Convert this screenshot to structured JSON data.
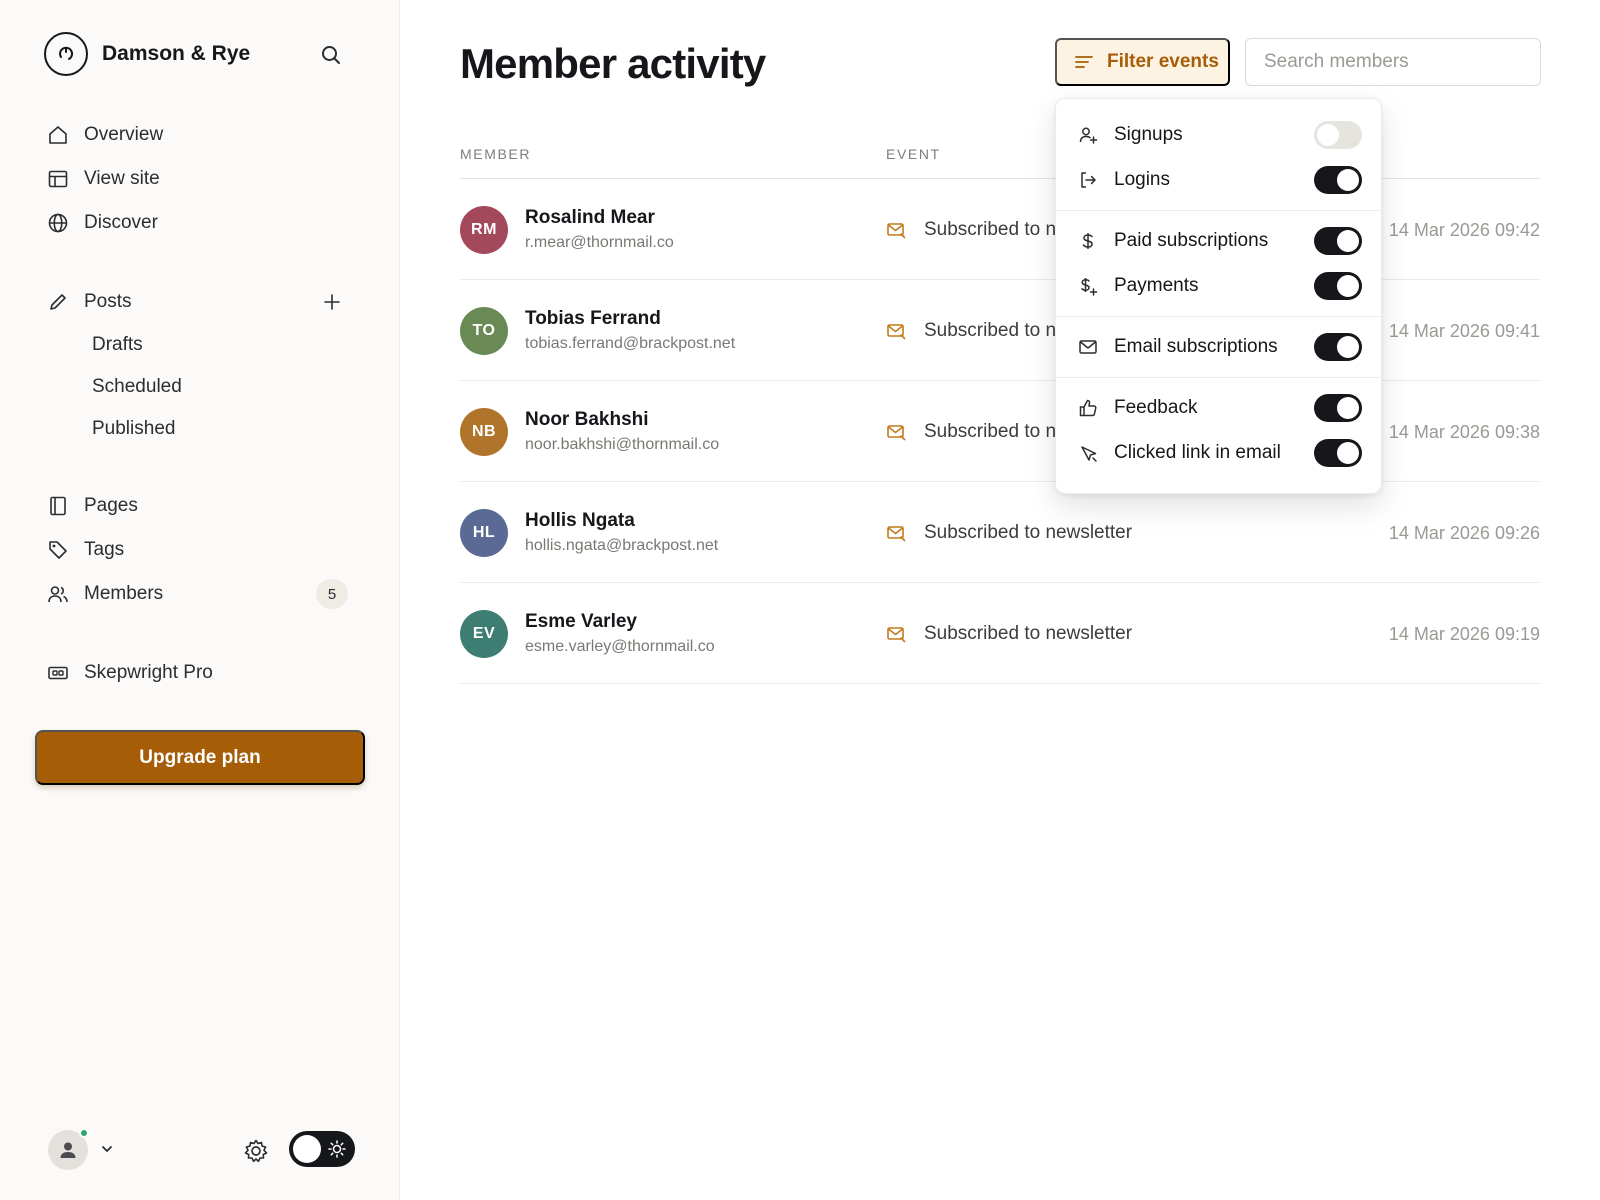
{
  "brand": {
    "name": "Damson & Rye"
  },
  "sidebar": {
    "primary": [
      {
        "label": "Overview",
        "icon": "home-icon"
      },
      {
        "label": "View site",
        "icon": "layout-icon"
      },
      {
        "label": "Discover",
        "icon": "globe-icon"
      }
    ],
    "posts": {
      "label": "Posts",
      "icon": "pencil-icon",
      "sub": [
        "Drafts",
        "Scheduled",
        "Published"
      ]
    },
    "secondary": [
      {
        "label": "Pages",
        "icon": "page-icon"
      },
      {
        "label": "Tags",
        "icon": "tag-icon"
      },
      {
        "label": "Members",
        "icon": "members-icon",
        "count": "5"
      }
    ],
    "pro": {
      "label": "Skepwright Pro",
      "icon": "ticket-icon"
    },
    "upgrade_label": "Upgrade plan"
  },
  "main": {
    "title": "Member activity",
    "filter_label": "Filter events",
    "search_placeholder": "Search members",
    "columns": {
      "member": "MEMBER",
      "event": "EVENT"
    },
    "rows": [
      {
        "initials": "RM",
        "color": "#a4495c",
        "name": "Rosalind Mear",
        "email": "r.mear@thornmail.co",
        "event": "Subscribed to n",
        "time": "14 Mar 2026 09:42"
      },
      {
        "initials": "TO",
        "color": "#6a8a55",
        "name": "Tobias Ferrand",
        "email": "tobias.ferrand@brackpost.net",
        "event": "Subscribed to n",
        "time": "14 Mar 2026 09:41"
      },
      {
        "initials": "NB",
        "color": "#b0752a",
        "name": "Noor Bakhshi",
        "email": "noor.bakhshi@thornmail.co",
        "event": "Subscribed to n",
        "time": "14 Mar 2026 09:38"
      },
      {
        "initials": "HL",
        "color": "#5a6a95",
        "name": "Hollis Ngata",
        "email": "hollis.ngata@brackpost.net",
        "event": "Subscribed to newsletter",
        "time": "14 Mar 2026 09:26"
      },
      {
        "initials": "EV",
        "color": "#3e7d72",
        "name": "Esme Varley",
        "email": "esme.varley@thornmail.co",
        "event": "Subscribed to newsletter",
        "time": "14 Mar 2026 09:19"
      }
    ]
  },
  "filter_menu": {
    "items": [
      {
        "label": "Signups",
        "icon": "user-plus-icon",
        "on": false
      },
      {
        "label": "Logins",
        "icon": "login-icon",
        "on": true
      },
      {
        "label": "Paid subscriptions",
        "icon": "dollar-icon",
        "on": true
      },
      {
        "label": "Payments",
        "icon": "dollar-plus-icon",
        "on": true
      },
      {
        "label": "Email subscriptions",
        "icon": "envelope-icon",
        "on": true
      },
      {
        "label": "Feedback",
        "icon": "thumbs-up-icon",
        "on": true
      },
      {
        "label": "Clicked link in email",
        "icon": "cursor-click-icon",
        "on": true
      }
    ]
  },
  "colors": {
    "accent": "#a65d08",
    "accent_bg": "#fdf3e3",
    "toggle_on": "#15171a"
  }
}
